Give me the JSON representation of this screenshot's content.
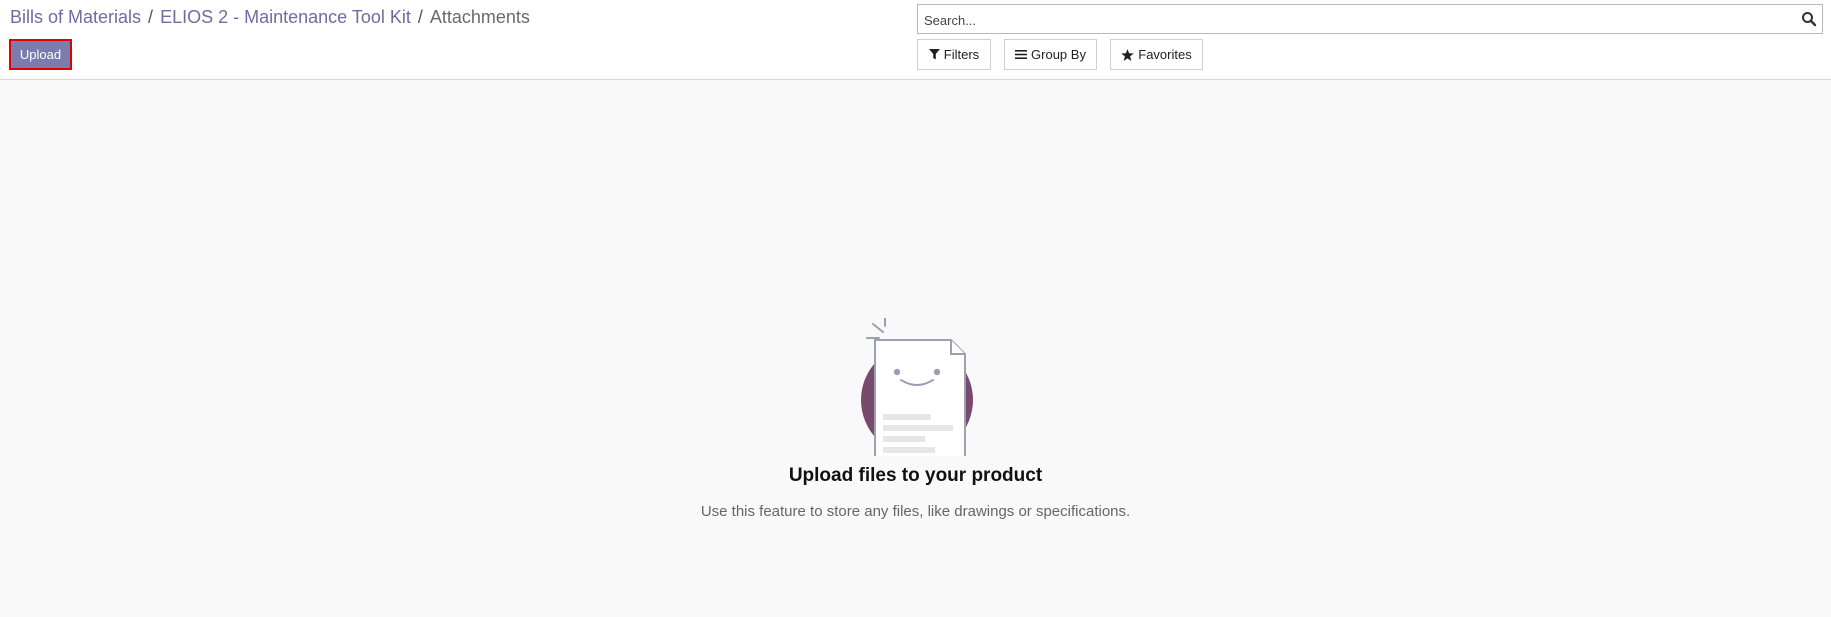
{
  "breadcrumb": {
    "items": [
      {
        "label": "Bills of Materials"
      },
      {
        "label": "ELIOS 2 - Maintenance Tool Kit"
      }
    ],
    "separator": "/",
    "current": "Attachments"
  },
  "toolbar": {
    "upload_label": "Upload"
  },
  "search": {
    "placeholder": "Search...",
    "value": "",
    "icon": "search-icon"
  },
  "filters": {
    "filters_label": "Filters",
    "group_by_label": "Group By",
    "favorites_label": "Favorites"
  },
  "empty_state": {
    "title": "Upload files to your product",
    "description": "Use this feature to store any files, like drawings or specifications."
  },
  "colors": {
    "accent": "#7c7bad",
    "breadcrumb_link": "#6f6ba3",
    "illustration_circle": "#7a4a6e",
    "highlight_border": "#e00000"
  }
}
